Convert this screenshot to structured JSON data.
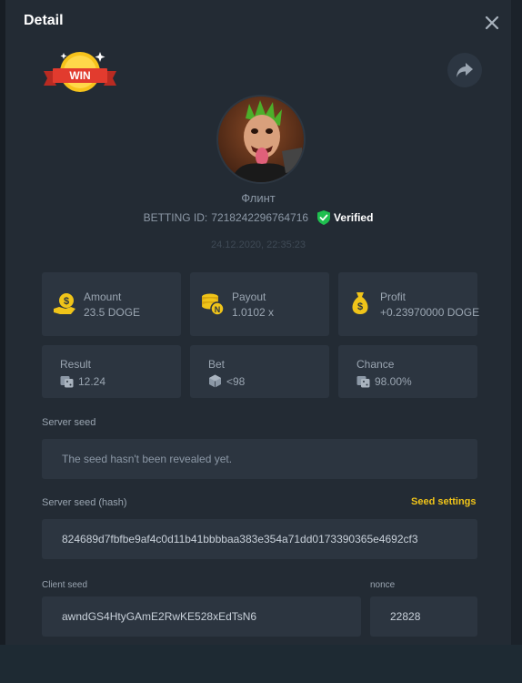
{
  "header": {
    "title": "Detail"
  },
  "badge": {
    "label": "WIN"
  },
  "player": {
    "name": "Флинт",
    "betting_id_label": "BETTING ID:",
    "betting_id": "7218242296764716",
    "verified_label": "Verified",
    "timestamp": "24.12.2020, 22:35:23"
  },
  "stats": {
    "amount": {
      "label": "Amount",
      "value": "23.5 DOGE"
    },
    "payout": {
      "label": "Payout",
      "value": "1.0102 x"
    },
    "profit": {
      "label": "Profit",
      "value": "+0.23970000 DOGE"
    },
    "result": {
      "label": "Result",
      "value": "12.24"
    },
    "bet": {
      "label": "Bet",
      "value": "<98"
    },
    "chance": {
      "label": "Chance",
      "value": "98.00%"
    }
  },
  "server_seed": {
    "label": "Server seed",
    "value": "The seed hasn't been revealed yet."
  },
  "server_seed_hash": {
    "label": "Server seed (hash)",
    "settings_label": "Seed settings",
    "value": "824689d7fbfbe9af4c0d11b41bbbbaa383e354a71dd0173390365e4692cf3"
  },
  "client_seed": {
    "label": "Client seed",
    "value": "awndGS4HtyGAmE2RwKE528xEdTsN6"
  },
  "nonce": {
    "label": "nonce",
    "value": "22828"
  },
  "colors": {
    "accent_yellow": "#f0c419",
    "verified_green": "#1fbf4f",
    "win_red": "#e23b2e"
  }
}
